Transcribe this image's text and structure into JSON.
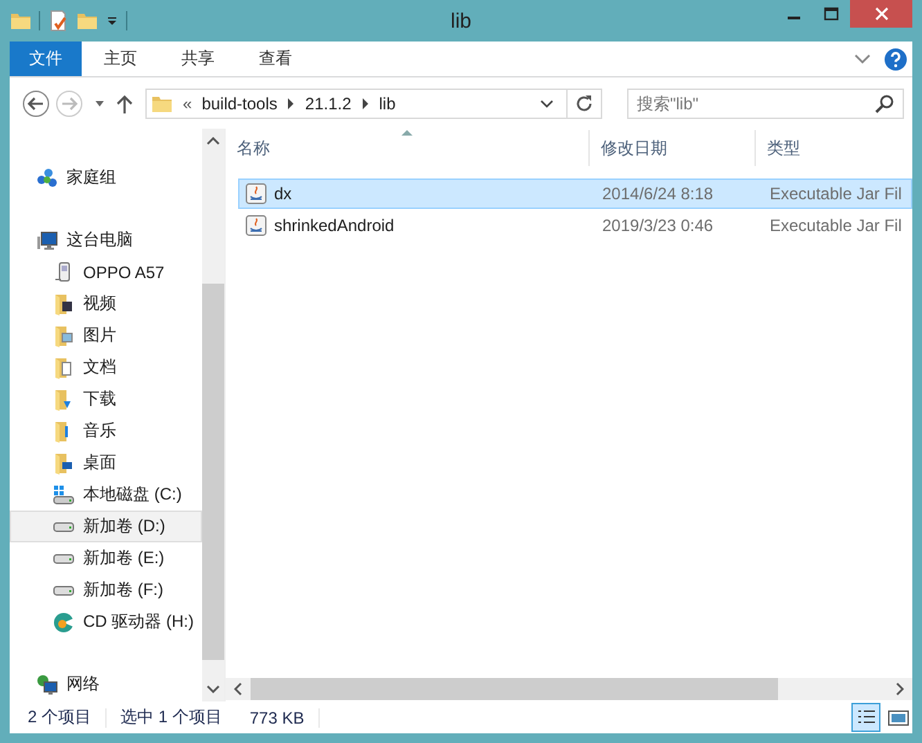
{
  "window": {
    "title": "lib"
  },
  "ribbon_tabs": [
    {
      "label": "文件",
      "kind": "file"
    },
    {
      "label": "主页",
      "kind": "tab"
    },
    {
      "label": "共享",
      "kind": "tab"
    },
    {
      "label": "查看",
      "kind": "tab"
    }
  ],
  "address_bar": {
    "overflow": "«",
    "segments": [
      "build-tools",
      "21.1.2",
      "lib"
    ]
  },
  "search": {
    "placeholder": "搜索\"lib\""
  },
  "sidebar": {
    "items": [
      {
        "label": "家庭组",
        "kind": "homegroup",
        "group": true,
        "selected": false
      },
      {
        "label": "这台电脑",
        "kind": "computer",
        "group": true,
        "selected": false
      },
      {
        "label": "OPPO A57",
        "kind": "phone",
        "group": false,
        "selected": false
      },
      {
        "label": "视频",
        "kind": "videos",
        "group": false,
        "selected": false
      },
      {
        "label": "图片",
        "kind": "pictures",
        "group": false,
        "selected": false
      },
      {
        "label": "文档",
        "kind": "documents",
        "group": false,
        "selected": false
      },
      {
        "label": "下载",
        "kind": "downloads",
        "group": false,
        "selected": false
      },
      {
        "label": "音乐",
        "kind": "music",
        "group": false,
        "selected": false
      },
      {
        "label": "桌面",
        "kind": "desktop",
        "group": false,
        "selected": false
      },
      {
        "label": "本地磁盘 (C:)",
        "kind": "systemdrive",
        "group": false,
        "selected": false
      },
      {
        "label": "新加卷 (D:)",
        "kind": "drive",
        "group": false,
        "selected": true
      },
      {
        "label": "新加卷 (E:)",
        "kind": "drive",
        "group": false,
        "selected": false
      },
      {
        "label": "新加卷 (F:)",
        "kind": "drive",
        "group": false,
        "selected": false
      },
      {
        "label": "CD 驱动器 (H:)",
        "kind": "disc",
        "group": false,
        "selected": false
      },
      {
        "label": "网络",
        "kind": "network",
        "group": true,
        "selected": false
      }
    ]
  },
  "table": {
    "columns": [
      {
        "label": "名称",
        "sorted": true
      },
      {
        "label": "修改日期",
        "sorted": false
      },
      {
        "label": "类型",
        "sorted": false
      }
    ],
    "rows": [
      {
        "name": "dx",
        "date": "2014/6/24 8:18",
        "type": "Executable Jar Fil",
        "selected": true
      },
      {
        "name": "shrinkedAndroid",
        "date": "2019/3/23 0:46",
        "type": "Executable Jar Fil",
        "selected": false
      }
    ]
  },
  "status_bar": {
    "item_count": "2 个项目",
    "selection": "选中 1 个项目",
    "size": "773 KB",
    "views": [
      {
        "kind": "details",
        "selected": true
      },
      {
        "kind": "tiles",
        "selected": false
      }
    ]
  }
}
